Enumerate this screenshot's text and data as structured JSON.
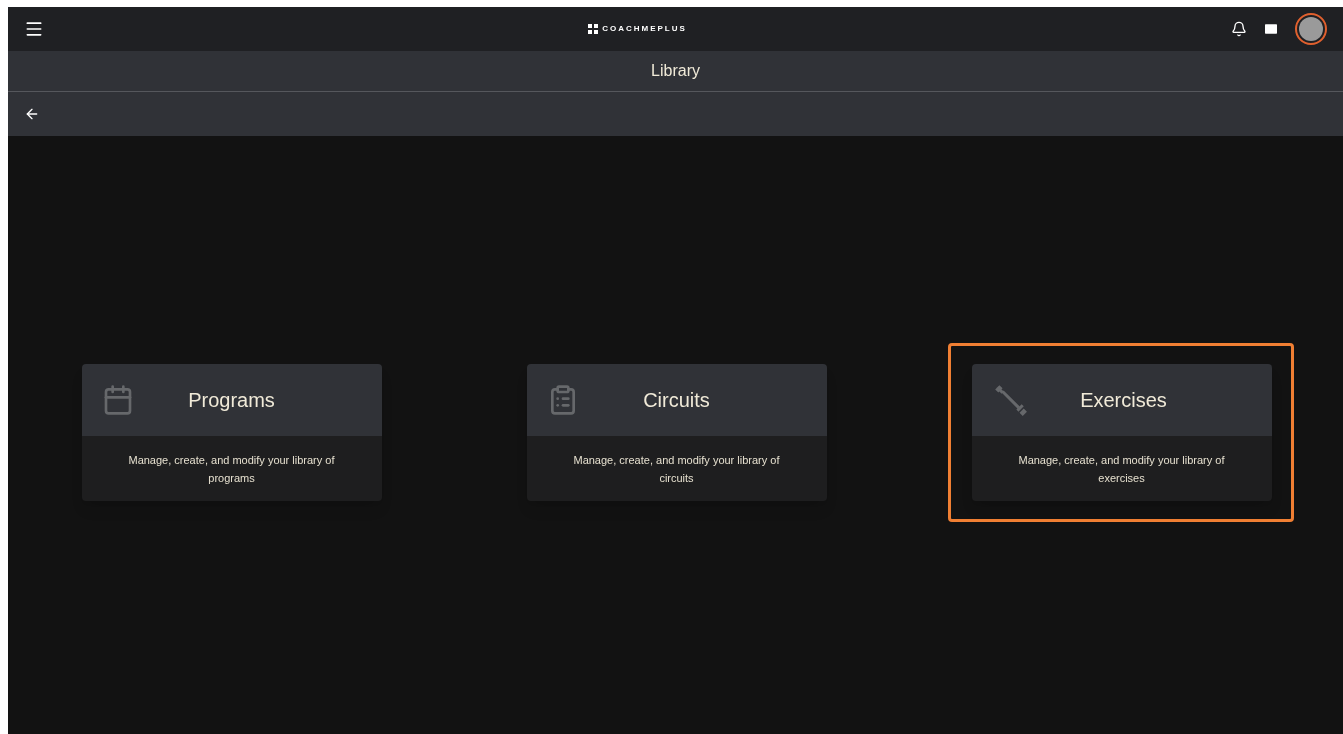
{
  "top_bar": {
    "logo_text": "COACHMEPLUS"
  },
  "title_bar": {
    "title": "Library"
  },
  "cards": [
    {
      "kind": "calendar",
      "title": "Programs",
      "description": "Manage, create, and modify your library of programs",
      "highlighted": false
    },
    {
      "kind": "clipboard",
      "title": "Circuits",
      "description": "Manage, create, and modify your library of circuits",
      "highlighted": false
    },
    {
      "kind": "dumbbell",
      "title": "Exercises",
      "description": "Manage, create, and modify your library of exercises",
      "highlighted": true
    }
  ]
}
